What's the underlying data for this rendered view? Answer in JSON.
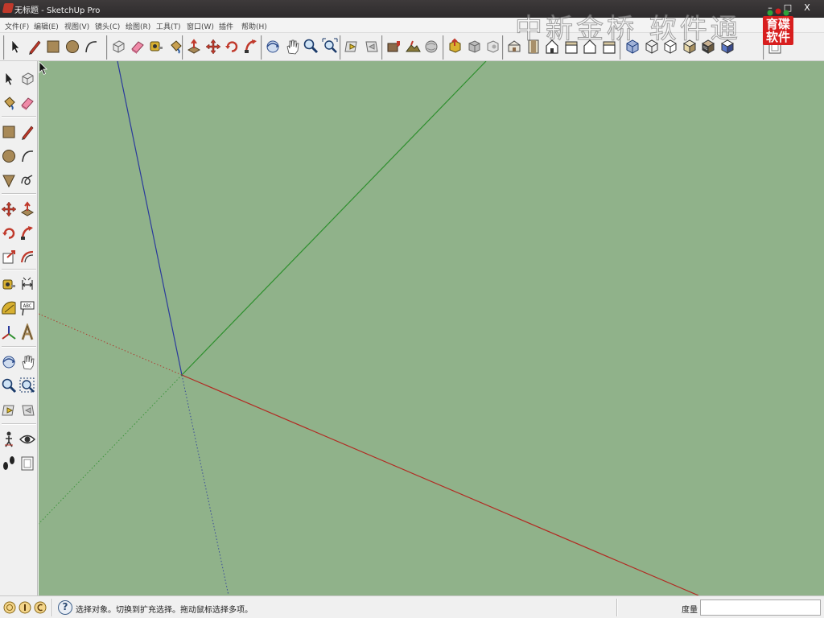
{
  "window": {
    "title": "无标题 - SketchUp Pro",
    "min_glyph": "–",
    "restore_glyph": "□",
    "close_glyph": "X"
  },
  "menu": [
    {
      "label": "文件(F)"
    },
    {
      "label": "编辑(E)"
    },
    {
      "label": "视图(V)"
    },
    {
      "label": "镜头(C)"
    },
    {
      "label": "绘图(R)"
    },
    {
      "label": "工具(T)"
    },
    {
      "label": "窗口(W)"
    },
    {
      "label": "插件"
    },
    {
      "label": "帮助(H)"
    }
  ],
  "watermark": {
    "text": "中新金桥 软件通",
    "logo_line1": "育碟",
    "logo_line2": "软件"
  },
  "toolbar_top": {
    "groups": [
      [
        "select-tool-icon",
        "pencil-line-tool-icon",
        "rectangle-tool-icon",
        "circle-tool-icon",
        "arc-tool-icon"
      ],
      [
        "make-component-icon",
        "eraser-tool-icon",
        "tape-measure-tool-icon",
        "paint-bucket-tool-icon"
      ],
      [
        "push-pull-tool-icon",
        "move-tool-icon",
        "rotate-tool-icon",
        "follow-me-tool-icon"
      ],
      [
        "orbit-tool-icon",
        "pan-tool-icon",
        "zoom-tool-icon",
        "zoom-extents-tool-icon"
      ],
      [
        "previous-view-icon",
        "next-view-icon"
      ],
      [
        "add-location-icon",
        "toggle-terrain-icon",
        "get-models-icon"
      ],
      [
        "share-model-icon",
        "share-component-icon",
        "get-photo-texture-icon"
      ],
      [
        "iso-view-icon",
        "top-view-icon",
        "front-view-icon",
        "right-view-icon",
        "back-view-icon",
        "left-view-icon"
      ],
      [
        "xray-style-icon",
        "wireframe-style-icon",
        "hidden-line-style-icon",
        "shaded-style-icon",
        "shaded-textures-style-icon",
        "monochrome-style-icon"
      ],
      [
        "section-plane-icon"
      ]
    ]
  },
  "toolbar_left": {
    "tools": [
      [
        "select-tool-icon",
        "make-component-icon"
      ],
      [
        "paint-bucket-tool-icon",
        "eraser-tool-icon"
      ],
      [
        "rectangle-tool-icon",
        "pencil-line-tool-icon"
      ],
      [
        "circle-tool-icon",
        "arc-tool-icon"
      ],
      [
        "polygon-tool-icon",
        "freehand-tool-icon"
      ],
      [
        "move-tool-icon",
        "push-pull-tool-icon"
      ],
      [
        "rotate-tool-icon",
        "follow-me-tool-icon"
      ],
      [
        "scale-tool-icon",
        "offset-tool-icon"
      ],
      [
        "tape-measure-tool-icon",
        "dimension-tool-icon"
      ],
      [
        "protractor-tool-icon",
        "text-tool-icon"
      ],
      [
        "axes-tool-icon",
        "3d-text-tool-icon"
      ],
      [
        "orbit-tool-icon",
        "pan-tool-icon"
      ],
      [
        "zoom-tool-icon",
        "zoom-window-tool-icon"
      ],
      [
        "previous-view-icon",
        "next-view-icon"
      ],
      [
        "position-camera-tool-icon",
        "look-around-tool-icon"
      ],
      [
        "walk-tool-icon",
        "section-plane-icon"
      ]
    ],
    "text_tool_label": "ABC"
  },
  "viewport": {
    "background_color": "#90b28a",
    "axis_colors": {
      "red": "#b22a22",
      "green": "#2e8f2e",
      "blue": "#2a3a9c"
    }
  },
  "statusbar": {
    "help_glyph": "?",
    "message": "选择对象。切换到扩充选择。拖动鼠标选择多项。",
    "measure_label": "度量",
    "measure_value": ""
  }
}
